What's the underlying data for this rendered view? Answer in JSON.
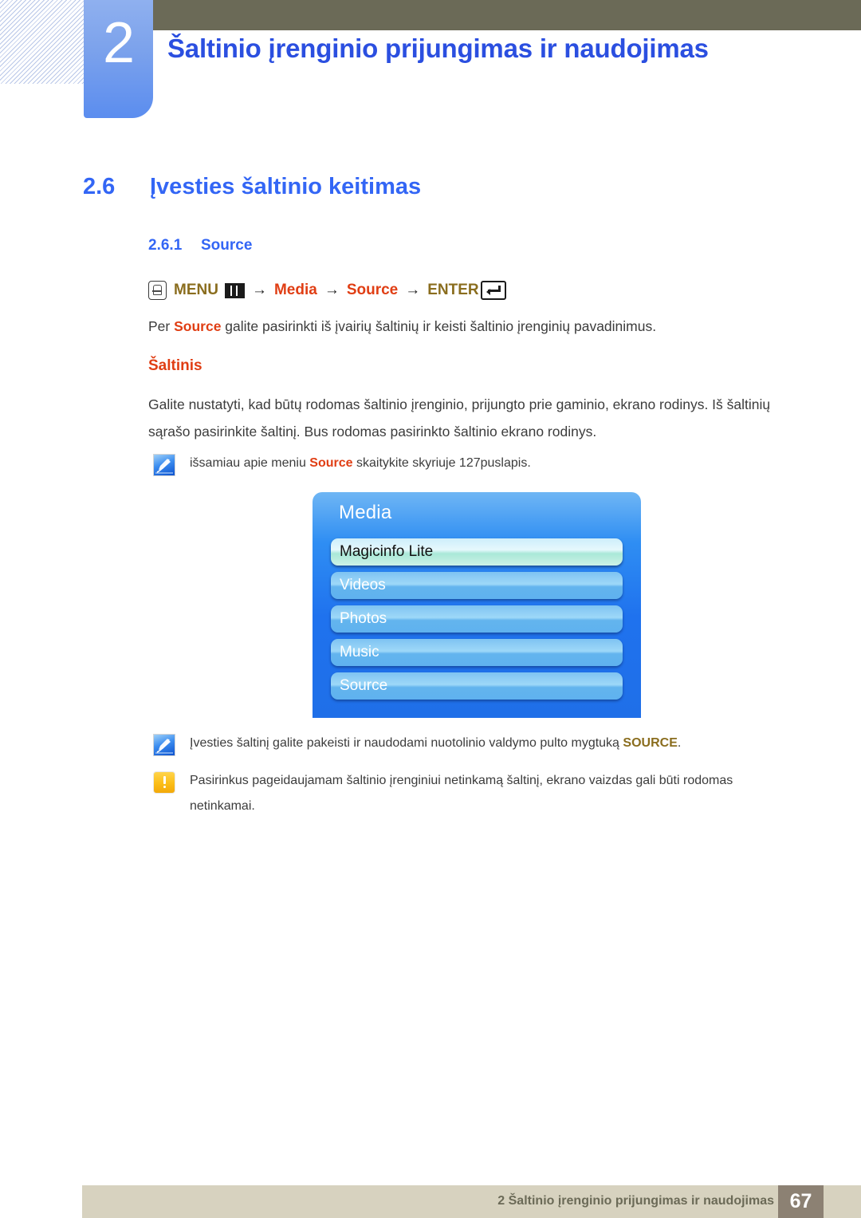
{
  "header": {
    "chapter_number": "2",
    "chapter_title": "Šaltinio įrenginio prijungimas ir naudojimas"
  },
  "section": {
    "number": "2.6",
    "title": "Įvesties šaltinio keitimas"
  },
  "subsection": {
    "number": "2.6.1",
    "title": "Source"
  },
  "menu_path": {
    "hand_icon": "hand-press-icon",
    "menu_label": "MENU",
    "menu_bars_icon": "menu-bars-icon",
    "arrow_1": "→",
    "media_label": "Media",
    "arrow_2": "→",
    "source_label": "Source",
    "arrow_3": "→",
    "enter_label": "ENTER",
    "enter_icon": "enter-key-icon"
  },
  "body": {
    "intro_before": "Per ",
    "intro_highlight": "Source",
    "intro_after": " galite pasirinkti iš įvairių šaltinių ir keisti šaltinio įrenginių pavadinimus.",
    "subheading": "Šaltinis",
    "paragraph": "Galite nustatyti, kad būtų rodomas šaltinio įrenginio, prijungto prie gaminio, ekrano rodinys. Iš šaltinių sąrašo pasirinkite šaltinį. Bus rodomas pasirinkto šaltinio ekrano rodinys."
  },
  "notes": [
    {
      "icon": "note-pen-icon",
      "before": "išsamiau apie meniu ",
      "highlight": "Source",
      "highlight_color": "red",
      "after": " skaitykite skyriuje 127puslapis."
    },
    {
      "icon": "note-pen-icon",
      "before": "Įvesties šaltinį galite pakeisti ir naudodami nuotolinio valdymo pulto mygtuką ",
      "highlight": "SOURCE",
      "highlight_color": "gold",
      "after": "."
    },
    {
      "icon": "warning-icon",
      "before": "Pasirinkus pageidaujamam šaltinio įrenginiui netinkamą šaltinį, ekrano vaizdas gali būti rodomas netinkamai.",
      "highlight": "",
      "highlight_color": "none",
      "after": ""
    }
  ],
  "osd_menu": {
    "title": "Media",
    "items": [
      {
        "label": "Magicinfo Lite",
        "selected": true
      },
      {
        "label": "Videos",
        "selected": false
      },
      {
        "label": "Photos",
        "selected": false
      },
      {
        "label": "Music",
        "selected": false
      },
      {
        "label": "Source",
        "selected": false
      }
    ]
  },
  "footer": {
    "text": "2 Šaltinio įrenginio prijungimas ir naudojimas",
    "page_number": "67"
  },
  "colors": {
    "heading_blue": "#3366f5",
    "title_blue": "#2b4fe0",
    "accent_red": "#e03e14",
    "accent_gold": "#8a6d1e",
    "olive": "#6b6a57",
    "footer_bg": "#d7d2bf",
    "page_box": "#8c8173",
    "osd_blue": "#1f72ee"
  }
}
